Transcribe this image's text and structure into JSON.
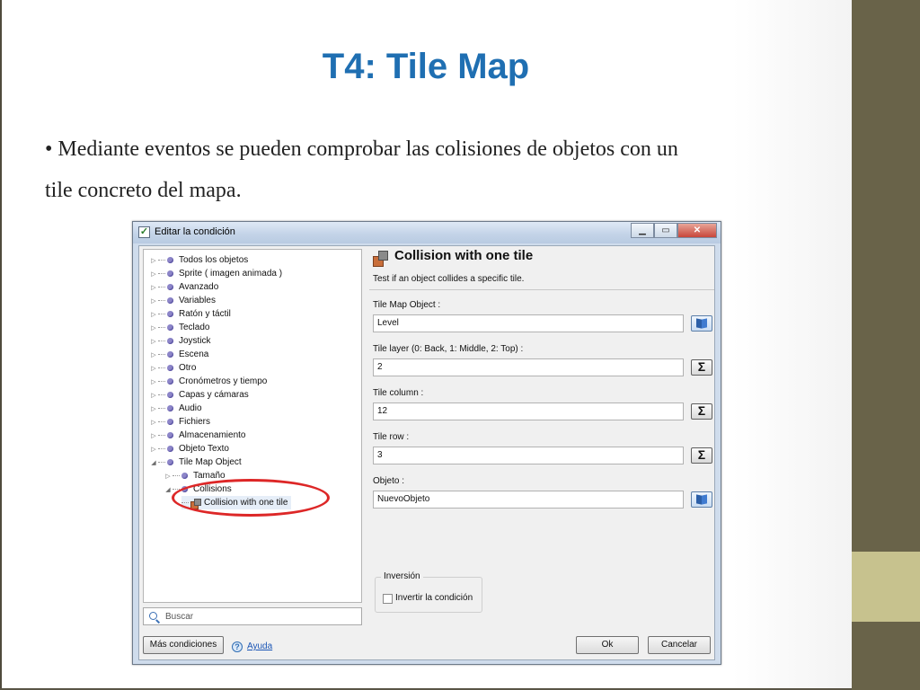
{
  "slide": {
    "title": "T4: Tile Map",
    "bullet_line1": "• Mediante eventos se pueden comprobar las colisiones de objetos con un",
    "bullet_line2": "tile concreto del mapa."
  },
  "window": {
    "title": "Editar la condición",
    "min_label": "▁",
    "max_label": "▭",
    "close_label": "✕"
  },
  "tree": {
    "items": [
      {
        "label": "Todos los objetos"
      },
      {
        "label": "Sprite ( imagen animada )"
      },
      {
        "label": "Avanzado"
      },
      {
        "label": "Variables"
      },
      {
        "label": "Ratón y táctil"
      },
      {
        "label": "Teclado"
      },
      {
        "label": "Joystick"
      },
      {
        "label": "Escena"
      },
      {
        "label": "Otro"
      },
      {
        "label": "Cronómetros y tiempo"
      },
      {
        "label": "Capas y cámaras"
      },
      {
        "label": "Audio"
      },
      {
        "label": "Fichiers"
      },
      {
        "label": "Almacenamiento"
      },
      {
        "label": "Objeto Texto"
      },
      {
        "label": "Tile Map Object"
      },
      {
        "label": "Tamaño"
      },
      {
        "label": "Collisions"
      },
      {
        "label": "Collision with one tile"
      }
    ]
  },
  "search": {
    "placeholder": "Buscar"
  },
  "footer": {
    "more_conditions": "Más condiciones",
    "help": "Ayuda",
    "ok": "Ok",
    "cancel": "Cancelar"
  },
  "condition": {
    "title": "Collision with one tile",
    "description": "Test if an object collides a specific tile.",
    "fields": [
      {
        "label": "Tile Map Object :",
        "value": "Level",
        "button": "object-picker"
      },
      {
        "label": "Tile layer (0: Back, 1: Middle, 2: Top) :",
        "value": "2",
        "button": "Σ"
      },
      {
        "label": "Tile column :",
        "value": "12",
        "button": "Σ"
      },
      {
        "label": "Tile row :",
        "value": "3",
        "button": "Σ"
      },
      {
        "label": "Objeto :",
        "value": "NuevoObjeto",
        "button": "object-picker"
      }
    ],
    "inversion_group": "Inversión",
    "invert_label": "Invertir la condición"
  },
  "colors": {
    "title_blue": "#1f6fb2",
    "highlight_red": "#dd2727",
    "side_bar": "#696349",
    "side_accent": "#c7c28e"
  }
}
